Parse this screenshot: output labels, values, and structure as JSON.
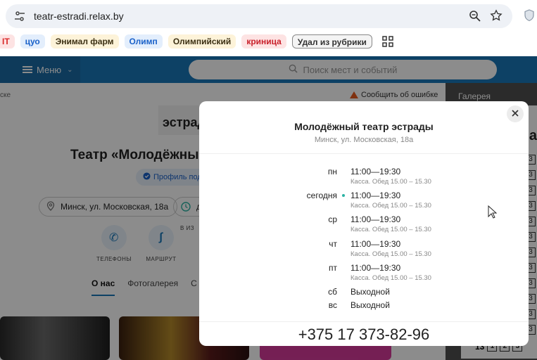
{
  "browser": {
    "url": "teatr-estradi.relax.by",
    "icons": [
      "tune-icon",
      "zoom-icon",
      "star-icon",
      "shield-icon",
      "apps-grid-icon"
    ],
    "bookmarks": [
      {
        "label": "IT"
      },
      {
        "label": "цуо"
      },
      {
        "label": "Энимал фарм"
      },
      {
        "label": "Олимп"
      },
      {
        "label": "Олимпийский"
      },
      {
        "label": "криница"
      },
      {
        "label": "Удал из рубрики"
      }
    ]
  },
  "site": {
    "menu_label": "Меню",
    "search_placeholder": "Поиск мест и событий",
    "breadcrumb_tail": "ске",
    "report_label": "Сообщить об ошибке",
    "gallery_label": "Галерея",
    "logo_text": "эстрады",
    "title": "Театр «Молодёжный",
    "verified_label": "Профиль подт",
    "address": "Минск, ул. Московская, 18а",
    "time_tail": "д",
    "actions": [
      {
        "label": "ТЕЛЕФОНЫ",
        "icon": "phone-icon"
      },
      {
        "label": "МАРШРУТ",
        "icon": "route-icon"
      },
      {
        "label": "В ИЗ",
        "icon": "favorite-icon"
      }
    ],
    "tabs": [
      {
        "label": "О нас",
        "active": true
      },
      {
        "label": "Фотогалерея"
      },
      {
        "label": "С"
      }
    ],
    "calendar_letter": "Па",
    "calendar_digits": [
      "3",
      "3",
      "3",
      "3",
      "3",
      "3",
      "3",
      "3",
      "3",
      "3",
      "3",
      "3",
      "3"
    ],
    "calendar_bottom": [
      "13",
      "1",
      "2",
      "3"
    ]
  },
  "modal": {
    "title": "Молодёжный театр эстрады",
    "subtitle": "Минск, ул. Московская, 18а",
    "schedule": [
      {
        "day": "пн",
        "hours": "11:00—19:30",
        "note": "Касса. Обед 15.00 – 15.30",
        "today": false
      },
      {
        "day": "сегодня",
        "hours": "11:00—19:30",
        "note": "Касса. Обед 15.00 – 15.30",
        "today": true
      },
      {
        "day": "ср",
        "hours": "11:00—19:30",
        "note": "Касса. Обед 15.00 – 15.30",
        "today": false
      },
      {
        "day": "чт",
        "hours": "11:00—19:30",
        "note": "Касса. Обед 15.00 – 15.30",
        "today": false
      },
      {
        "day": "пт",
        "hours": "11:00—19:30",
        "note": "Касса. Обед 15.00 – 15.30",
        "today": false
      },
      {
        "day": "сб",
        "hours": "Выходной",
        "note": "",
        "today": false
      },
      {
        "day": "вс",
        "hours": "Выходной",
        "note": "",
        "today": false
      }
    ],
    "phone": "+375 17 373-82-96"
  },
  "colors": {
    "site_nav": "#1877b8",
    "today_dot": "#2bb3a3",
    "report_icon": "#e85a1c"
  }
}
